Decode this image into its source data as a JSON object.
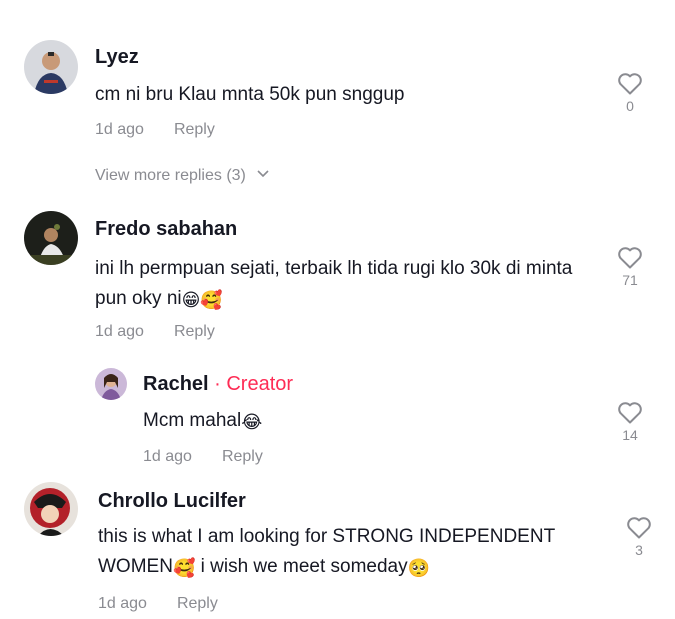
{
  "comments": [
    {
      "name": "Lyez",
      "text": "cm ni bru Klau mnta 50k pun snggup",
      "time": "1d ago",
      "reply_label": "Reply",
      "likes": "0",
      "view_more": "View more replies (3)"
    },
    {
      "name": "Fredo sabahan",
      "text": "ini lh permpuan sejati, terbaik lh tida rugi klo 30k di minta pun oky ni",
      "emojis": "😁🥰",
      "time": "1d ago",
      "reply_label": "Reply",
      "likes": "71"
    },
    {
      "name": "Rachel",
      "badge": " · Creator",
      "text": "Mcm mahal",
      "emojis": "😂",
      "time": "1d ago",
      "reply_label": "Reply",
      "likes": "14"
    },
    {
      "name": "Chrollo Lucilfer",
      "text_part1": "this is what I am looking for STRONG INDEPENDENT WOMEN",
      "emoji1": "🥰",
      "text_part2": " i wish we meet someday",
      "emoji2": "🥺",
      "time": "1d ago",
      "reply_label": "Reply",
      "likes": "3"
    }
  ],
  "colors": {
    "text": "#161823",
    "muted": "#8a8b91",
    "creator": "#fe2c55"
  },
  "icons": [
    "heart-icon",
    "chevron-down-icon",
    "avatar"
  ]
}
